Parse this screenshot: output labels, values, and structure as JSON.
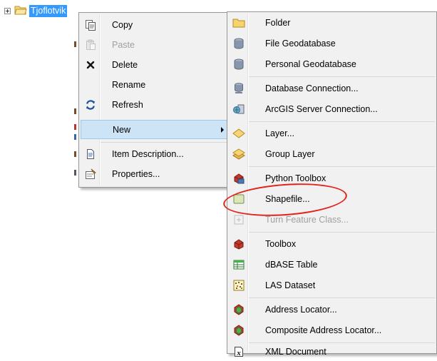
{
  "tree": {
    "label": "Tjoflotvik"
  },
  "context_menu": {
    "items": [
      {
        "label": "Copy",
        "icon": "copy-icon",
        "enabled": true
      },
      {
        "label": "Paste",
        "icon": "paste-icon",
        "enabled": false
      },
      {
        "label": "Delete",
        "icon": "delete-icon",
        "enabled": true
      },
      {
        "label": "Rename",
        "icon": "",
        "enabled": true
      },
      {
        "label": "Refresh",
        "icon": "refresh-icon",
        "enabled": true
      },
      {
        "label": "New",
        "icon": "",
        "enabled": true,
        "highlighted": true,
        "has_submenu": true
      },
      {
        "label": "Item Description...",
        "icon": "item-description-icon",
        "enabled": true
      },
      {
        "label": "Properties...",
        "icon": "properties-icon",
        "enabled": true
      }
    ]
  },
  "new_submenu": {
    "items": [
      {
        "label": "Folder",
        "icon": "folder-icon",
        "enabled": true
      },
      {
        "label": "File Geodatabase",
        "icon": "geodatabase-icon",
        "enabled": true
      },
      {
        "label": "Personal Geodatabase",
        "icon": "geodatabase-icon",
        "enabled": true
      },
      {
        "label": "Database Connection...",
        "icon": "database-connection-icon",
        "enabled": true
      },
      {
        "label": "ArcGIS Server Connection...",
        "icon": "server-connection-icon",
        "enabled": true
      },
      {
        "label": "Layer...",
        "icon": "layer-icon",
        "enabled": true
      },
      {
        "label": "Group Layer",
        "icon": "group-layer-icon",
        "enabled": true
      },
      {
        "label": "Python Toolbox",
        "icon": "python-toolbox-icon",
        "enabled": true
      },
      {
        "label": "Shapefile...",
        "icon": "shapefile-icon",
        "enabled": true
      },
      {
        "label": "Turn Feature Class...",
        "icon": "turn-feature-class-icon",
        "enabled": false
      },
      {
        "label": "Toolbox",
        "icon": "toolbox-icon",
        "enabled": true
      },
      {
        "label": "dBASE Table",
        "icon": "dbase-table-icon",
        "enabled": true
      },
      {
        "label": "LAS Dataset",
        "icon": "las-dataset-icon",
        "enabled": true
      },
      {
        "label": "Address Locator...",
        "icon": "address-locator-icon",
        "enabled": true
      },
      {
        "label": "Composite Address Locator...",
        "icon": "composite-address-locator-icon",
        "enabled": true
      },
      {
        "label": "XML Document",
        "icon": "xml-document-icon",
        "enabled": true
      }
    ]
  },
  "colors": {
    "highlight": "#cde4f7",
    "selection": "#3399ff",
    "annotation": "#e0231c"
  }
}
